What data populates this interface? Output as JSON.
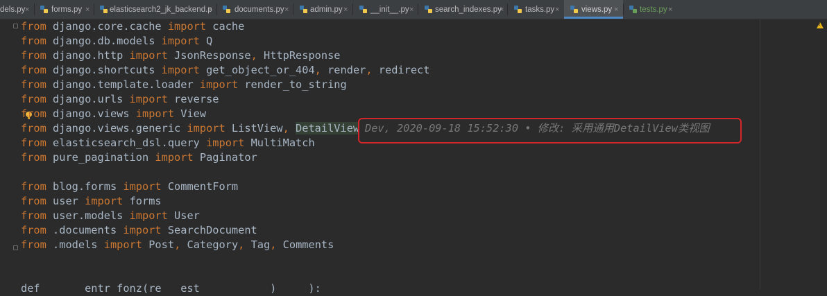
{
  "tabs": [
    {
      "label": "dels.py",
      "active": false,
      "color": "#bbbbbb"
    },
    {
      "label": "forms.py",
      "active": false,
      "color": "#bbbbbb"
    },
    {
      "label": "elasticsearch2_jk_backend.p",
      "active": false,
      "color": "#bbbbbb"
    },
    {
      "label": "documents.py",
      "active": false,
      "color": "#bbbbbb"
    },
    {
      "label": "admin.py",
      "active": false,
      "color": "#bbbbbb"
    },
    {
      "label": "__init__.py",
      "active": false,
      "color": "#bbbbbb"
    },
    {
      "label": "search_indexes.py",
      "active": false,
      "color": "#bbbbbb"
    },
    {
      "label": "tasks.py",
      "active": false,
      "color": "#bbbbbb"
    },
    {
      "label": "views.py",
      "active": true,
      "color": "#bbbbbb"
    },
    {
      "label": "tests.py",
      "active": false,
      "color": "#6a9f5a"
    }
  ],
  "close_glyph": "×",
  "editor": {
    "lines": [
      [
        "from",
        " django.core.cache ",
        "import",
        " cache"
      ],
      [
        "from",
        " django.db.models ",
        "import",
        " Q"
      ],
      [
        "from",
        " django.http ",
        "import",
        " JsonResponse",
        ",",
        " HttpResponse"
      ],
      [
        "from",
        " django.shortcuts ",
        "import",
        " get_object_or_404",
        ",",
        " render",
        ",",
        " redirect"
      ],
      [
        "from",
        " django.template.loader ",
        "import",
        " render_to_string"
      ],
      [
        "from",
        " django.urls ",
        "import",
        " reverse"
      ],
      [
        "from",
        " django.views ",
        "import",
        " View"
      ],
      [
        "from",
        " django.views.generic ",
        "import",
        " ListView",
        ",",
        " ",
        "DetailView"
      ],
      [
        "from",
        " elasticsearch_dsl.query ",
        "import",
        " MultiMatch"
      ],
      [
        "from",
        " pure_pagination ",
        "import",
        " Paginator"
      ],
      [],
      [
        "from",
        " blog.forms ",
        "import",
        " CommentForm"
      ],
      [
        "from",
        " user ",
        "import",
        " forms"
      ],
      [
        "from",
        " user.models ",
        "import",
        " User"
      ],
      [
        "from",
        " .documents ",
        "import",
        " SearchDocument"
      ],
      [
        "from",
        " .models ",
        "import",
        " Post",
        ",",
        " Category",
        ",",
        " Tag",
        ",",
        " Comments"
      ]
    ],
    "blame_annotation": "Dev, 2020-09-18 15:52:30 • 修改: 采用通用DetailView类视图",
    "partial_bottom_line": "def       entr fonz(re   est           )     ):"
  },
  "colors": {
    "keyword": "#cc7832",
    "identifier": "#a9b7c6",
    "annotation": "#787878",
    "highlight_box": "#d2262a",
    "active_tab_underline": "#4a88c7",
    "background": "#2b2b2b"
  }
}
